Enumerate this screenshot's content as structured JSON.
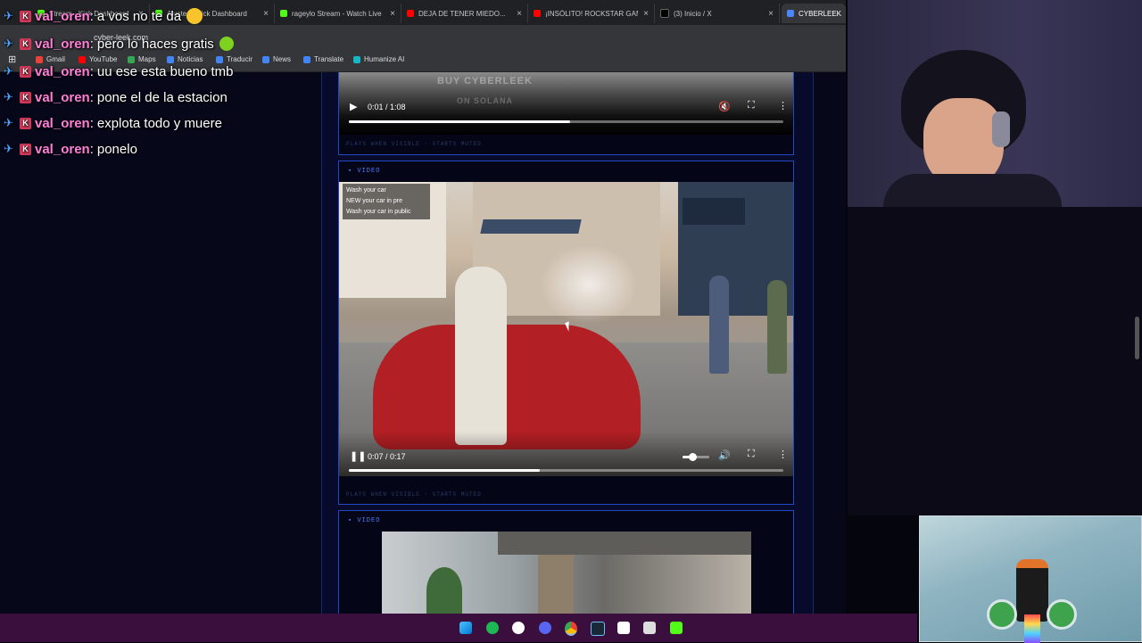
{
  "browser": {
    "tabs": [
      {
        "label": "Stream - Kick Dashboard",
        "color": "#53fc18"
      },
      {
        "label": "Ajustes - Kick Dashboard",
        "color": "#53fc18"
      },
      {
        "label": "rageylo Stream - Watch Live",
        "color": "#53fc18"
      },
      {
        "label": "DEJA DE TENER MIEDO...",
        "color": "#ff0000"
      },
      {
        "label": "¡INSÓLITO! ROCKSTAR GAMES",
        "color": "#ff0000"
      },
      {
        "label": "(3) Inicio / X",
        "color": "#000000"
      },
      {
        "label": "CYBERLEEK",
        "color": "#4a86ff"
      }
    ],
    "url": "cyber-leek.com",
    "bookmarks": [
      {
        "label": "Gmail",
        "color": "#ea4335"
      },
      {
        "label": "YouTube",
        "color": "#ff0000"
      },
      {
        "label": "Maps",
        "color": "#34a853"
      },
      {
        "label": "Noticias",
        "color": "#4285f4"
      },
      {
        "label": "Traducir",
        "color": "#4285f4"
      },
      {
        "label": "News",
        "color": "#4285f4"
      },
      {
        "label": "Translate",
        "color": "#4285f4"
      },
      {
        "label": "Humanize AI",
        "color": "#16b8c8"
      }
    ]
  },
  "page": {
    "video1": {
      "watermark_line1": "BUY CYBERLEEK",
      "watermark_line2": "ON SOLANA",
      "time": "0:01 / 1:08",
      "progress": 0.51,
      "footer": "PLAYS WHEN VISIBLE · STARTS MUTED"
    },
    "video2": {
      "label": "VIDEO",
      "caption_line1": "Wash your car",
      "caption_line2": "NEW your car in pre",
      "caption_line3": "Wash your car in public",
      "time": "0:07 / 0:17",
      "progress": 0.44,
      "volume": 0.35,
      "footer": "PLAYS WHEN VISIBLE · STARTS MUTED"
    },
    "video3": {
      "label": "VIDEO"
    }
  },
  "chat": [
    {
      "user": "val_oren",
      "message": "a vos no te da"
    },
    {
      "user": "val_oren",
      "message": "pero lo haces gratis"
    },
    {
      "user": "val_oren",
      "message": "uu ese esta bueno tmb"
    },
    {
      "user": "val_oren",
      "message": "pone el de la estacion"
    },
    {
      "user": "val_oren",
      "message": "explota todo y muere"
    },
    {
      "user": "val_oren",
      "message": "ponelo"
    }
  ],
  "taskbar": {
    "icons": [
      "windows-start-icon",
      "spotify-icon",
      "chatgpt-icon",
      "discord-icon",
      "chrome-icon",
      "steam-icon",
      "capcut-icon",
      "obs-icon",
      "kick-icon"
    ]
  }
}
